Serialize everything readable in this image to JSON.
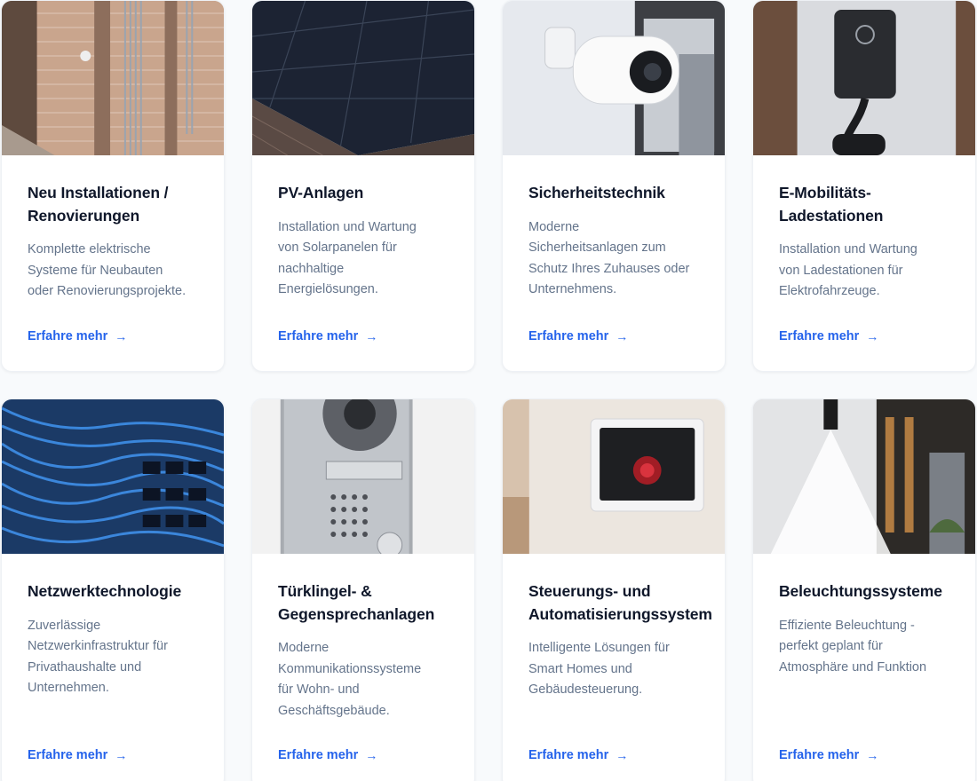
{
  "services": [
    {
      "title": "Neu Installationen /\nRenovierungen",
      "description": "Komplette elektrische\nSysteme für Neubauten\noder Renovierungsprojekte.",
      "link": "Erfahre mehr",
      "image": "brick-wall-wiring-photo"
    },
    {
      "title": "PV-Anlagen",
      "description": "Installation und Wartung\nvon Solarpanelen für\nnachhaltige\nEnergielösungen.",
      "link": "Erfahre mehr",
      "image": "solar-panels-roof-photo"
    },
    {
      "title": "Sicherheitstechnik",
      "description": "Moderne\nSicherheitsanlagen zum\nSchutz Ihres Zuhauses oder\nUnternehmens.",
      "link": "Erfahre mehr",
      "image": "security-camera-photo"
    },
    {
      "title": "E-Mobilitäts-\nLadestationen",
      "description": "Installation und Wartung\nvon Ladestationen für\nElektrofahrzeuge.",
      "link": "Erfahre mehr",
      "image": "ev-charger-photo"
    },
    {
      "title": "Netzwerktechnologie",
      "description": "Zuverlässige\nNetzwerkinfrastruktur für\nPrivathaushalte und\nUnternehmen.",
      "link": "Erfahre mehr",
      "image": "network-cables-photo"
    },
    {
      "title": "Türklingel- &\nGegensprechanlagen",
      "description": "Moderne\nKommunikationssysteme\nfür Wohn- und\nGeschäftsgebäude.",
      "link": "Erfahre mehr",
      "image": "door-intercom-photo"
    },
    {
      "title": "Steuerungs- und\nAutomatisierungssystem",
      "description": "Intelligente Lösungen für\nSmart Homes und\nGebäudesteuerung.",
      "link": "Erfahre mehr",
      "image": "smart-home-panel-photo"
    },
    {
      "title": "Beleuchtungssysteme",
      "description": "Effiziente Beleuchtung -\nperfekt geplant für\nAtmosphäre und Funktion",
      "link": "Erfahre mehr",
      "image": "outdoor-lighting-photo"
    }
  ],
  "link_arrow": "→",
  "colors": {
    "accent": "#2563eb",
    "title": "#0f172a",
    "text": "#64748b",
    "background": "#f8fafc"
  }
}
